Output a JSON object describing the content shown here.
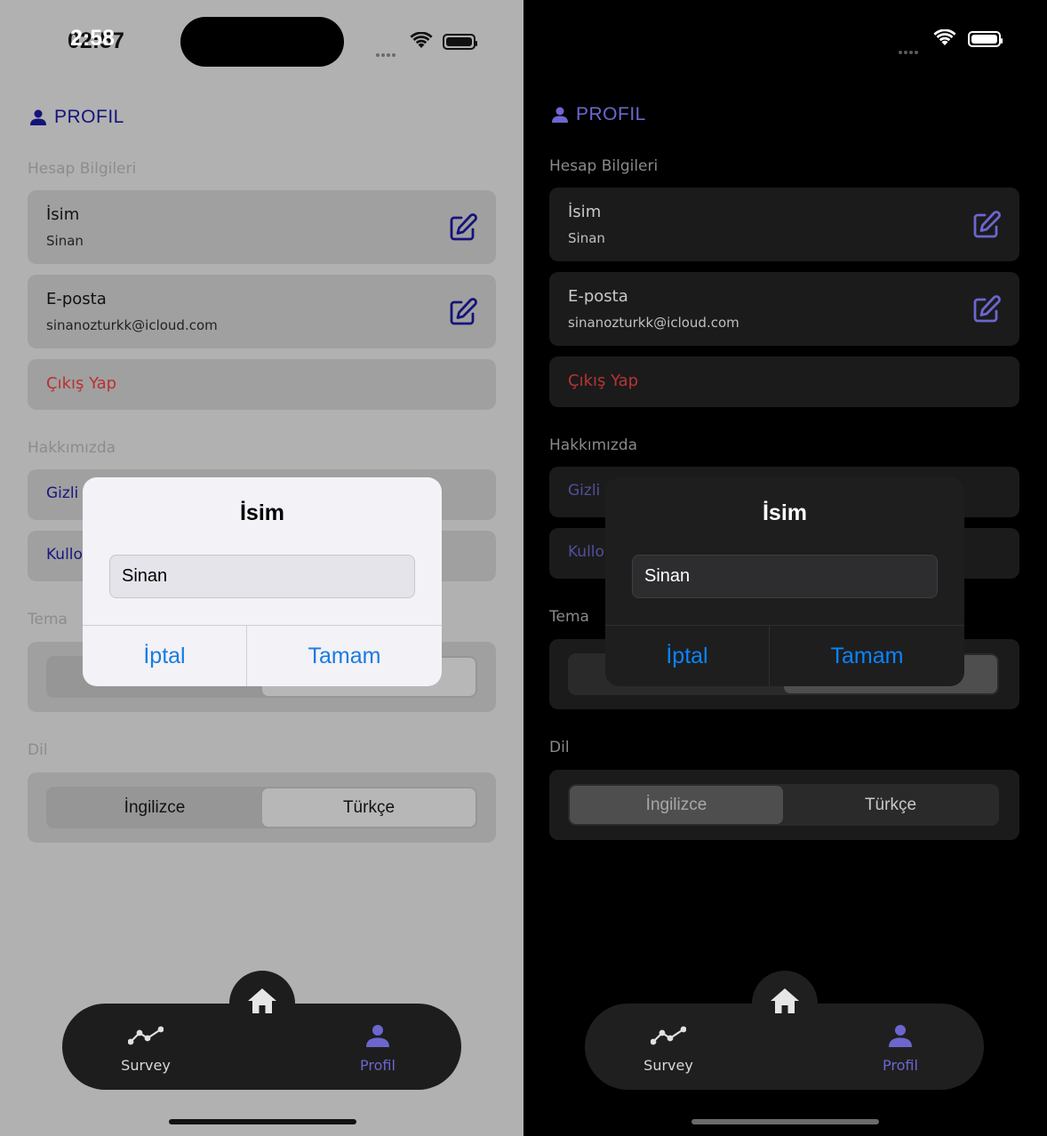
{
  "screens": {
    "light": {
      "status": {
        "time": "02:57"
      },
      "header": {
        "title": "PROFIL",
        "icon": "person-icon"
      },
      "account": {
        "section": "Hesap Bilgileri",
        "name_label": "İsim",
        "name_value": "Sinan",
        "email_label": "E-posta",
        "email_value": "sinanozturkk@icloud.com",
        "logout": "Çıkış Yap"
      },
      "about": {
        "section": "Hakkımızda",
        "privacy_visible": "Gizli",
        "terms_visible": "Kullo"
      },
      "theme": {
        "section": "Tema"
      },
      "language": {
        "section": "Dil",
        "options": [
          "İngilizce",
          "Türkçe"
        ],
        "selected": "Türkçe"
      },
      "dialog": {
        "title": "İsim",
        "input_value": "Sinan",
        "cancel": "İptal",
        "ok": "Tamam"
      },
      "tabbar": {
        "tabs": [
          {
            "label": "Survey",
            "icon": "trend-icon"
          },
          {
            "label": "Profil",
            "icon": "person-icon"
          }
        ],
        "center_icon": "home-icon",
        "active": "Profil"
      }
    },
    "dark": {
      "status": {
        "time": "2:58"
      },
      "header": {
        "title": "PROFIL",
        "icon": "person-icon"
      },
      "account": {
        "section": "Hesap Bilgileri",
        "name_label": "İsim",
        "name_value": "Sinan",
        "email_label": "E-posta",
        "email_value": "sinanozturkk@icloud.com",
        "logout": "Çıkış Yap"
      },
      "about": {
        "section": "Hakkımızda",
        "privacy_visible": "Gizli",
        "terms_visible": "Kullo"
      },
      "theme": {
        "section": "Tema"
      },
      "language": {
        "section": "Dil",
        "options": [
          "İngilizce",
          "Türkçe"
        ],
        "selected": "İngilizce"
      },
      "dialog": {
        "title": "İsim",
        "input_value": "Sinan",
        "cancel": "İptal",
        "ok": "Tamam"
      },
      "tabbar": {
        "tabs": [
          {
            "label": "Survey",
            "icon": "trend-icon"
          },
          {
            "label": "Profil",
            "icon": "person-icon"
          }
        ],
        "center_icon": "home-icon",
        "active": "Profil"
      }
    }
  },
  "colors": {
    "accent_light": "#14147a",
    "accent_dark": "#6d67d0",
    "destructive": "#bb2f2f",
    "dialog_button": "#0a84ff"
  }
}
